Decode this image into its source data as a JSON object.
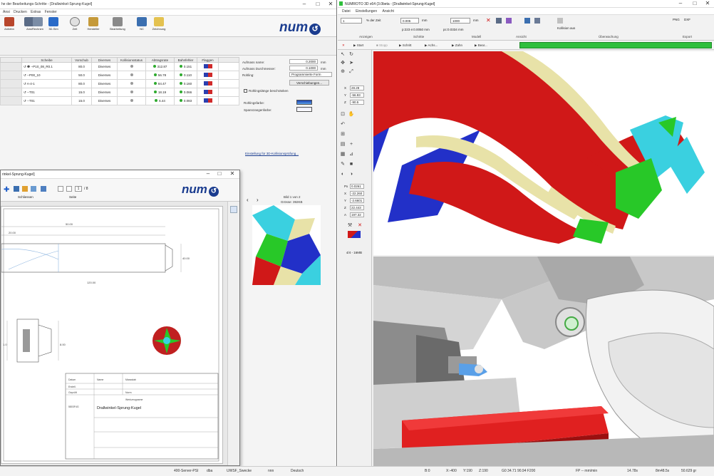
{
  "left_window": {
    "title": "he der Bearbeitungs-Schritte - [Drallwinkel-Sprung-Kugel]",
    "menu": [
      "Ansi",
      "Drucken",
      "Extras",
      "Fenster"
    ],
    "toolbar": [
      "Anhebn",
      "Ansi",
      "Rechnen",
      "3D-Sim",
      "Zeit",
      "Hersteller",
      "Bearbeitung",
      "NC",
      "Zeichnung"
    ],
    "table": {
      "headers": [
        "Scheibe",
        "Vorschub",
        "Diverses",
        "Kollisionsstatus",
        "Abtragsrate",
        "Bahnfehler",
        "Flaggen"
      ],
      "rows": [
        {
          "name": "--P10_08_R0.1",
          "feed": "80.0",
          "div": "Diverses",
          "rate": "312.87",
          "err": "0.151"
        },
        {
          "name": "--P00_10",
          "feed": "50.0",
          "div": "Diverses",
          "rate": "56.78",
          "err": "0.110"
        },
        {
          "name": "A-4-1",
          "feed": "80.0",
          "div": "Diverses",
          "rate": "84.47",
          "err": "0.160"
        },
        {
          "name": "--T01",
          "feed": "15.0",
          "div": "Diverses",
          "rate": "18.19",
          "err": "0.066"
        },
        {
          "name": "--T01",
          "feed": "15.0",
          "div": "Diverses",
          "rate": "6.44",
          "err": "0.083"
        }
      ]
    },
    "panel": {
      "aufmass_name": "Aufmass name:",
      "aufmass_val": "0.2000",
      "aufmass_unit": "mm",
      "dm_label": "Aufmass Durchmesser:",
      "dm_val": "0.1000",
      "dm_unit": "mm",
      "rohling_label": "Rohling:",
      "rohling_val": "Programmierte Form",
      "verschieb": "Verschiebungen...",
      "check_label": "Rohlingslänge beschränken",
      "rohfarbe": "Rohlingsfarbe:",
      "spannfarbe": "Spannzangenfarbe:",
      "link": "Einstellung für 3D-Kollisionsprüfung..."
    },
    "preview": {
      "caption1": "Bild 1 von 2",
      "caption2": "Grösse: 392KB"
    }
  },
  "pdf_window": {
    "title": "rinkel-Sprung-Kugel]",
    "page_num": "1",
    "page_total": "/ 8",
    "tool_label_a": "Schliessen",
    "tool_label_b": "Seite",
    "drawing": {
      "name": "Drallwinkel-Sprung-Kugel",
      "number": "5803F4G",
      "material": "Werkzeugname",
      "rows": [
        "Datum",
        "Name",
        "Massstab",
        "Erstell.",
        "Geprüft",
        "Norm"
      ],
      "dims": [
        "20.00",
        "50.00",
        "100.00",
        "40.00",
        "1.0",
        "8.00",
        "120.00"
      ]
    }
  },
  "right_window": {
    "title": "NUMROTO 3D x64 (3.0beta - [Drallwinkel-Sprung-Kugel]",
    "menu": [
      "Datei",
      "Einstellungen",
      "Ansicht"
    ],
    "tool_fields": [
      "1",
      "% der Zeit",
      "0.005",
      "mm",
      "1000",
      "mm"
    ],
    "pos_readouts": [
      "p:223 e:0.0050 mm",
      "pc:0.0334 mm"
    ],
    "collision_label": "Kollision aus",
    "group_labels": [
      "Anzeigen",
      "Schritte",
      "Modell",
      "Ansicht",
      "Überwachung",
      "Export"
    ],
    "playback": [
      "Start",
      "Stopp",
      "Schritt",
      "Achs...",
      "Zahn",
      "Bear..."
    ],
    "coords": [
      {
        "axis": "X",
        "val": "28.28"
      },
      {
        "axis": "Y",
        "val": "-56.93"
      },
      {
        "axis": "Z",
        "val": "-90.5"
      }
    ],
    "coords2": [
      {
        "axis": "Px",
        "val": "0.0261"
      },
      {
        "axis": "X",
        "val": "-22.260"
      },
      {
        "axis": "Y",
        "val": "-2.6601"
      },
      {
        "axis": "Z",
        "val": "22.443"
      },
      {
        "axis": "A",
        "val": "197.32"
      }
    ],
    "side_footer": "4/4 - 16MB",
    "export": [
      "PNG",
      "DXF"
    ]
  },
  "taskbar": {
    "items": [
      "400-Server-PSI",
      "dba",
      "UWSF_Swecke",
      "nnn",
      "Deutsch"
    ],
    "status": [
      "B:0",
      "X:-400",
      "Y:190",
      "Z:190",
      "G0 34.71 90.94 F200",
      "FP -- mm/min",
      "14.78s",
      "8m48.5s",
      "50.629 gr"
    ]
  },
  "colors": {
    "num_blue": "#1a3c8f",
    "progress": "#2fbf3c",
    "tool_red": "#d01818",
    "tool_cream": "#e8e2a8",
    "tool_cyan": "#3ad0e0",
    "tool_green": "#28c828",
    "tool_blue": "#2230c8"
  }
}
